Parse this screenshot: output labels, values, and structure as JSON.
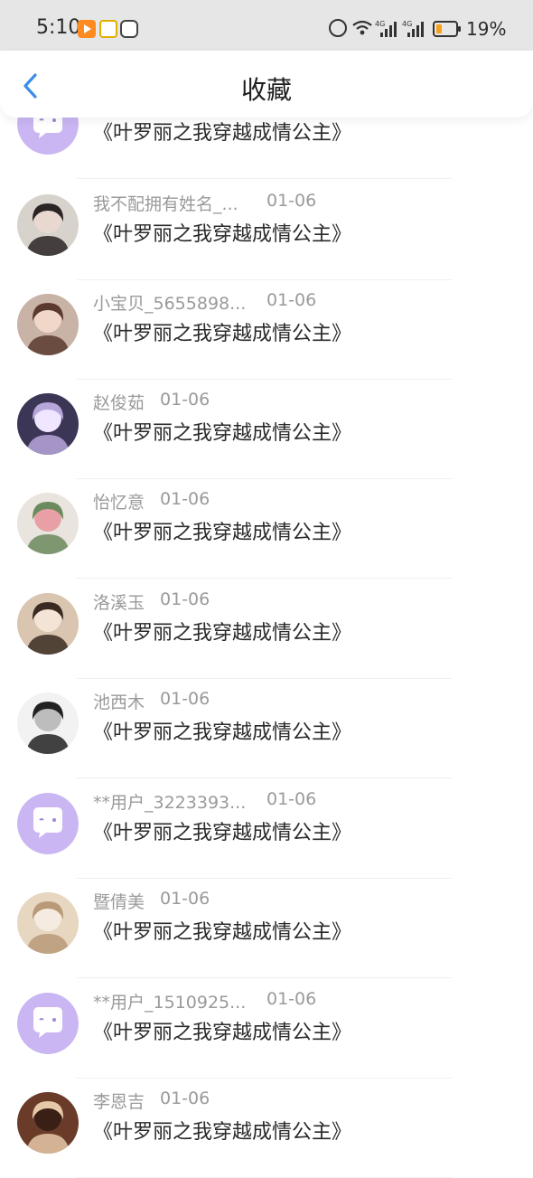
{
  "status_bar": {
    "time": "5:10",
    "battery": "19%",
    "network_1": "4G",
    "network_2": "4G"
  },
  "header": {
    "title": "收藏"
  },
  "accent_color": "#3a8ee6",
  "default_avatar_color": "#c9b6f2",
  "items": [
    {
      "name": "",
      "date": "",
      "title": "《叶罗丽之我穿越成情公主》",
      "avatar": "default-bubble"
    },
    {
      "name": "我不配拥有姓名_...",
      "date": "01-06",
      "title": "《叶罗丽之我穿越成情公主》",
      "avatar": "photo"
    },
    {
      "name": "小宝贝_5655898...",
      "date": "01-06",
      "title": "《叶罗丽之我穿越成情公主》",
      "avatar": "photo"
    },
    {
      "name": "赵俊茹",
      "date": "01-06",
      "title": "《叶罗丽之我穿越成情公主》",
      "avatar": "photo"
    },
    {
      "name": "怡忆意",
      "date": "01-06",
      "title": "《叶罗丽之我穿越成情公主》",
      "avatar": "photo"
    },
    {
      "name": "洛溪玉",
      "date": "01-06",
      "title": "《叶罗丽之我穿越成情公主》",
      "avatar": "photo"
    },
    {
      "name": "池西木",
      "date": "01-06",
      "title": "《叶罗丽之我穿越成情公主》",
      "avatar": "photo"
    },
    {
      "name": "**用户_3223393...",
      "date": "01-06",
      "title": "《叶罗丽之我穿越成情公主》",
      "avatar": "default-bubble"
    },
    {
      "name": "暨倩美",
      "date": "01-06",
      "title": "《叶罗丽之我穿越成情公主》",
      "avatar": "photo"
    },
    {
      "name": "**用户_1510925...",
      "date": "01-06",
      "title": "《叶罗丽之我穿越成情公主》",
      "avatar": "default-bubble"
    },
    {
      "name": "李恩吉",
      "date": "01-06",
      "title": "《叶罗丽之我穿越成情公主》",
      "avatar": "photo"
    }
  ]
}
